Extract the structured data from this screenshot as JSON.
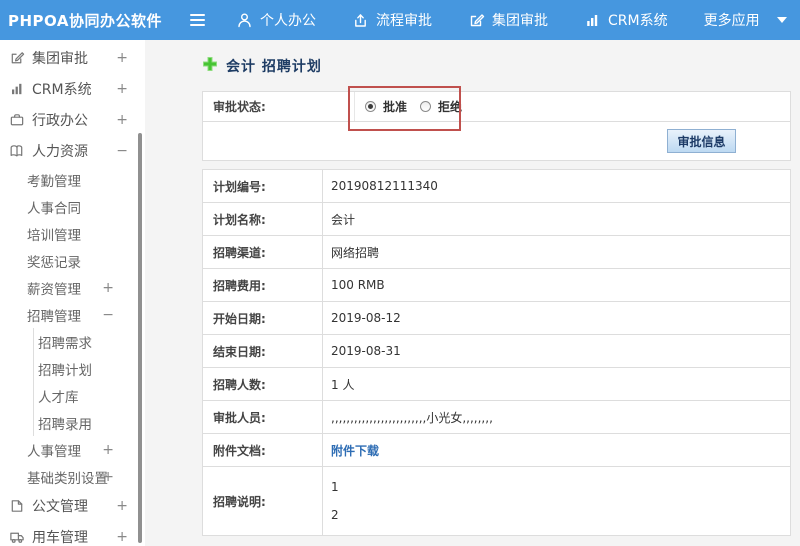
{
  "colors": {
    "navbar_blue": "#4697df",
    "annotation_red": "#c0504d",
    "link_blue": "#2e6db4",
    "plus_green": "#46c433"
  },
  "navbar": {
    "brand": "PHPOA协同办公软件",
    "items": [
      {
        "label": "个人办公",
        "icon": "user-icon"
      },
      {
        "label": "流程审批",
        "icon": "flow-icon"
      },
      {
        "label": "集团审批",
        "icon": "edit-icon"
      },
      {
        "label": "CRM系统",
        "icon": "chart-icon"
      },
      {
        "label": "更多应用",
        "icon": "caret-down-icon"
      }
    ]
  },
  "sidebar": {
    "items": [
      {
        "label": "集团审批",
        "expander": "+",
        "level": 1,
        "icon": "edit-square-icon"
      },
      {
        "label": "CRM系统",
        "expander": "+",
        "level": 1,
        "icon": "bar-chart-icon"
      },
      {
        "label": "行政办公",
        "expander": "+",
        "level": 1,
        "icon": "briefcase-icon"
      },
      {
        "label": "人力资源",
        "expander": "−",
        "level": 1,
        "icon": "book-icon"
      },
      {
        "label": "考勤管理",
        "expander": "",
        "level": 2
      },
      {
        "label": "人事合同",
        "expander": "",
        "level": 2
      },
      {
        "label": "培训管理",
        "expander": "",
        "level": 2
      },
      {
        "label": "奖惩记录",
        "expander": "",
        "level": 2
      },
      {
        "label": "薪资管理",
        "expander": "+",
        "level": 2
      },
      {
        "label": "招聘管理",
        "expander": "−",
        "level": 2
      },
      {
        "label": "招聘需求",
        "expander": "",
        "level": 3
      },
      {
        "label": "招聘计划",
        "expander": "",
        "level": 3
      },
      {
        "label": "人才库",
        "expander": "",
        "level": 3
      },
      {
        "label": "招聘录用",
        "expander": "",
        "level": 3
      },
      {
        "label": "人事管理",
        "expander": "+",
        "level": 2
      },
      {
        "label": "基础类别设置",
        "expander": "+",
        "level": 2
      },
      {
        "label": "公文管理",
        "expander": "+",
        "level": 1,
        "icon": "document-icon"
      },
      {
        "label": "用车管理",
        "expander": "+",
        "level": 1,
        "icon": "truck-icon"
      }
    ]
  },
  "main": {
    "page_title": "会计 招聘计划",
    "approval": {
      "status_label": "审批状态:",
      "options": [
        {
          "label": "批准",
          "checked": true
        },
        {
          "label": "拒绝",
          "checked": false
        }
      ],
      "button_label": "审批信息"
    },
    "details": {
      "rows": [
        {
          "label": "计划编号:",
          "value": "20190812111340"
        },
        {
          "label": "计划名称:",
          "value": "会计"
        },
        {
          "label": "招聘渠道:",
          "value": "网络招聘"
        },
        {
          "label": "招聘费用:",
          "value": "100 RMB"
        },
        {
          "label": "开始日期:",
          "value": "2019-08-12"
        },
        {
          "label": "结束日期:",
          "value": "2019-08-31"
        },
        {
          "label": "招聘人数:",
          "value": "1 人"
        },
        {
          "label": "审批人员:",
          "value": ",,,,,,,,,,,,,,,,,,,,,,,,,小光女,,,,,,,,"
        }
      ],
      "attachment_label": "附件文档:",
      "attachment_link": "附件下载",
      "description_label": "招聘说明:",
      "description_lines": [
        "1",
        "2"
      ]
    }
  }
}
